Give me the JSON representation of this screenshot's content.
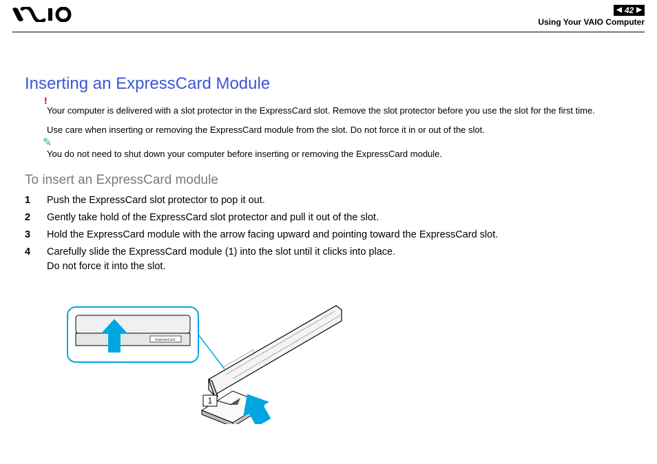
{
  "header": {
    "page_number": "42",
    "section": "Using Your VAIO Computer"
  },
  "title": "Inserting an ExpressCard Module",
  "warning": {
    "mark": "!",
    "text": "Your computer is delivered with a slot protector in the ExpressCard slot. Remove the slot protector before you use the slot for the first time."
  },
  "caution": "Use care when inserting or removing the ExpressCard module from the slot. Do not force it in or out of the slot.",
  "note": {
    "mark": "✎",
    "text": "You do not need to shut down your computer before inserting or removing the ExpressCard module."
  },
  "subhead": "To insert an ExpressCard module",
  "steps": [
    {
      "n": "1",
      "text": "Push the ExpressCard slot protector to pop it out."
    },
    {
      "n": "2",
      "text": "Gently take hold of the ExpressCard slot protector and pull it out of the slot."
    },
    {
      "n": "3",
      "text": "Hold the ExpressCard module with the arrow facing upward and pointing toward the ExpressCard slot."
    },
    {
      "n": "4",
      "text": "Carefully slide the ExpressCard module (1) into the slot until it clicks into place.\nDo not force it into the slot."
    }
  ],
  "figure": {
    "callout": "1",
    "slot_label": "ExpressCard"
  }
}
